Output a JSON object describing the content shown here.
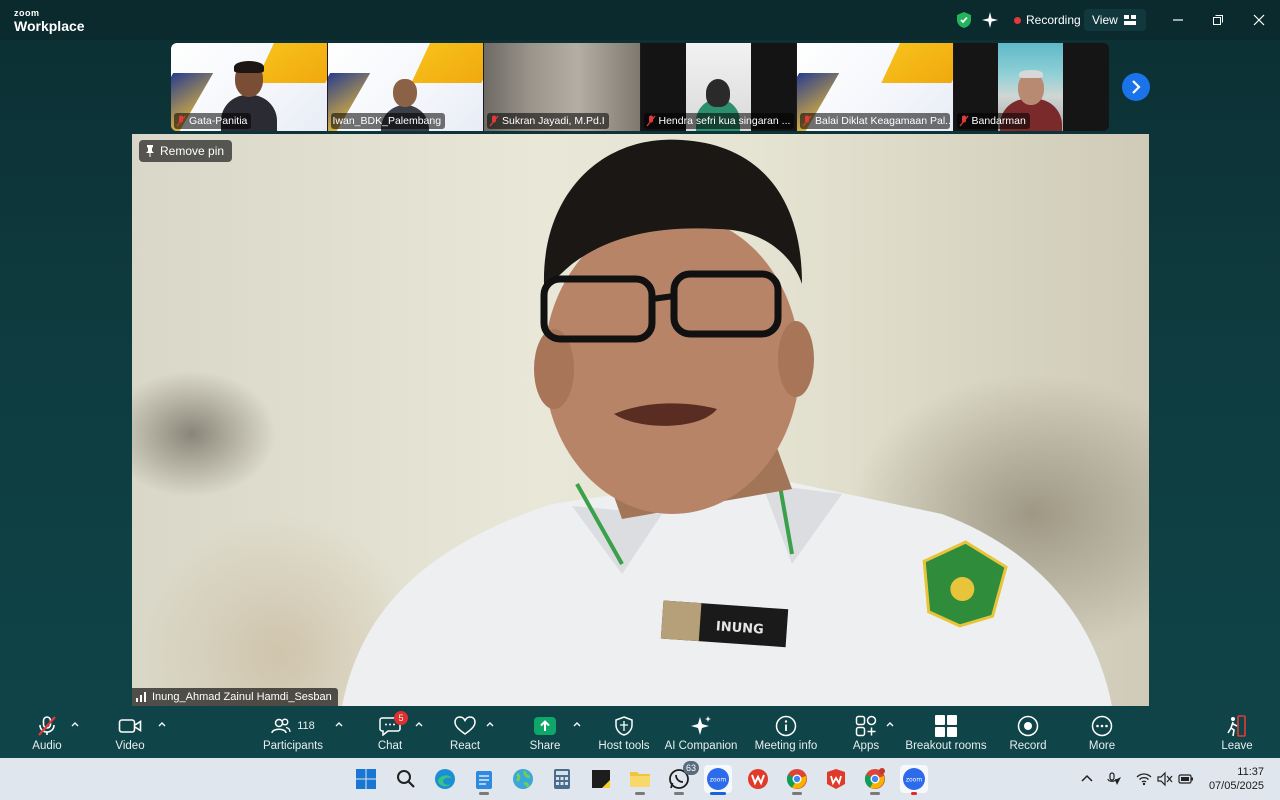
{
  "app": {
    "brand_small": "zoom",
    "brand_large": "Workplace"
  },
  "titlebar": {
    "recording_label": "Recording",
    "view_label": "View"
  },
  "participants_strip": [
    {
      "name": "Gata-Panitia",
      "muted": true,
      "kind": "person-slide"
    },
    {
      "name": "Iwan_BDK_Palembang",
      "muted": false,
      "kind": "person-slide"
    },
    {
      "name": "Sukran Jayadi, M.Pd.I",
      "muted": true,
      "kind": "blank"
    },
    {
      "name": "Hendra sefri kua singaran ...",
      "muted": true,
      "kind": "person-dark"
    },
    {
      "name": "Balai Diklat Keagamaan Pal...",
      "muted": true,
      "kind": "slide"
    },
    {
      "name": "Bandarman",
      "muted": true,
      "kind": "person"
    }
  ],
  "main_video": {
    "remove_pin_label": "Remove pin",
    "speaker_name": "Inung_Ahmad Zainul Hamdi_Sesban",
    "name_tag_text": "INUNG"
  },
  "toolbar": {
    "audio": "Audio",
    "video": "Video",
    "participants": "Participants",
    "participants_count": "118",
    "chat": "Chat",
    "chat_badge": "5",
    "react": "React",
    "share": "Share",
    "host_tools": "Host tools",
    "ai_companion": "AI Companion",
    "meeting_info": "Meeting info",
    "apps": "Apps",
    "breakout_rooms": "Breakout rooms",
    "record": "Record",
    "more": "More",
    "leave": "Leave"
  },
  "taskbar": {
    "whatsapp_badge": "63",
    "time": "11:37",
    "date": "07/05/2025"
  },
  "colors": {
    "accent": "#1a73e8",
    "share_green": "#0fa66a",
    "record_red": "#e23a3a"
  }
}
